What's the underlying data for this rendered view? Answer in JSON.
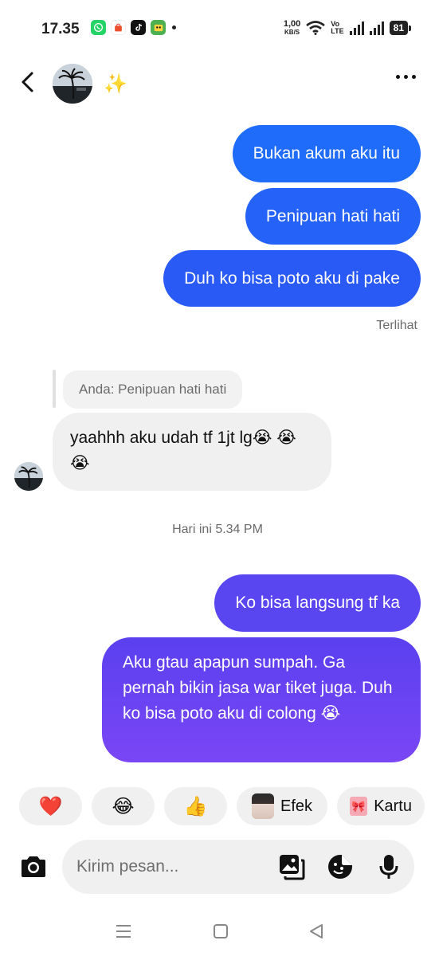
{
  "status_bar": {
    "time": "17.35",
    "net_speed_value": "1,00",
    "net_speed_unit": "KB/S",
    "volte_top": "Vo",
    "volte_bottom": "LTE",
    "battery": "81"
  },
  "header": {
    "contact_name": "✨",
    "icons": {
      "back": "back-arrow-icon",
      "more": "more-dots-icon"
    }
  },
  "messages": {
    "sent_1": "Bukan akum aku itu",
    "sent_2": "Penipuan hati hati",
    "sent_3": "Duh ko bisa poto aku di pake",
    "seen_status": "Terlihat",
    "reply_quote": "Anda: Penipuan hati hati",
    "received_1": "yaahhh aku udah tf 1jt lg😭 😭😭",
    "time_separator": "Hari ini 5.34 PM",
    "sent_4": "Ko bisa langsung tf ka",
    "sent_5": "Aku gtau apapun sumpah. Ga pernah bikin jasa war tiket juga. Duh ko bisa poto aku di colong 😭"
  },
  "quick_reactions": {
    "heart": "❤️",
    "laugh": "😂",
    "thumbs_up": "👍",
    "effects_label": "Efek",
    "card_label": "Kartu"
  },
  "composer": {
    "placeholder": "Kirim pesan..."
  },
  "colors": {
    "sent_blue": "#1f6bfa",
    "sent_purple_start": "#5a40ef",
    "sent_purple_end": "#7a46f5",
    "received_bg": "#f0f0f0"
  }
}
